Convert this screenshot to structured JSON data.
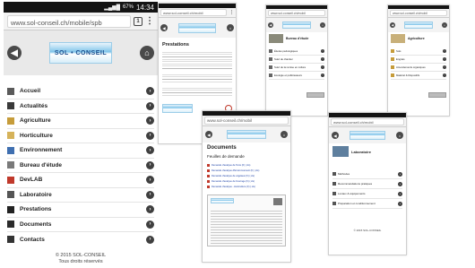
{
  "phone1": {
    "status": {
      "signal": "▂▄▆█",
      "battery": "67%",
      "time": "14:34"
    },
    "url": "www.sol-conseil.ch/mobile/spb",
    "tab_count": "1",
    "menu_glyph": "⋮",
    "logo_text": "SOL • CONSEIL",
    "menu": [
      {
        "label": "Accueil",
        "icon": "home-icon",
        "color": "#5a5a5a"
      },
      {
        "label": "Actualités",
        "icon": "news-icon",
        "color": "#3a3a3a"
      },
      {
        "label": "Agriculture",
        "icon": "agriculture-icon",
        "color": "#c69c3a"
      },
      {
        "label": "Horticulture",
        "icon": "horticulture-icon",
        "color": "#d6b35a"
      },
      {
        "label": "Environnement",
        "icon": "environment-icon",
        "color": "#3f6fb0"
      },
      {
        "label": "Bureau d'étude",
        "icon": "study-office-icon",
        "color": "#7a7a7a"
      },
      {
        "label": "DevLAB",
        "icon": "devlab-icon",
        "color": "#c0392b"
      },
      {
        "label": "Laboratoire",
        "icon": "lab-icon",
        "color": "#555555"
      },
      {
        "label": "Prestations",
        "icon": "services-icon",
        "color": "#222222"
      },
      {
        "label": "Documents",
        "icon": "documents-icon",
        "color": "#2b2b2b"
      },
      {
        "label": "Contacts",
        "icon": "contacts-icon",
        "color": "#333333"
      }
    ],
    "footer_line1": "© 2015 SOL-CONSEIL",
    "footer_line2": "Tous droits réservés"
  },
  "phone2": {
    "url": "www.sol-conseil.ch/mobil",
    "title": "Prestations"
  },
  "phone3": {
    "url": "www.sol-conseil.ch/mobil",
    "title": "Bureau d'étude",
    "items": [
      "Études pédologiques",
      "Suivi de chantier",
      "Suivi de la remise en culture",
      "Ecologie et pollinisateurs"
    ]
  },
  "phone4": {
    "url": "www.sol-conseil.ch/mobil",
    "title": "Agriculture",
    "items": [
      "Sols",
      "Engrais",
      "Amendements organiques",
      "Matériel & Dispositifs"
    ]
  },
  "phone5": {
    "url": "www.sol-conseil.ch/mobil",
    "title": "Documents",
    "subtitle": "Feuilles de demande",
    "links": [
      "Demande d'analyse de Terre (fr) (.xls)",
      "Demande d'analyse d'Environnement (fr) (.xls)",
      "Demande d'analyse de végétaux (fr) (.xls)",
      "Demande d'analyse de Fourrage (fr) (.xls)",
      "Demande d'analyse - Horticulture (fr) (.xls)"
    ]
  },
  "phone6": {
    "url": "www.sol-conseil.ch/mobil",
    "title": "Laboratoire",
    "items": [
      "Méthodes",
      "Recommandations pratiques",
      "Locaux & équipements",
      "Préparation et conditionnement"
    ],
    "footer": "© 2015 SOL-CONSEIL"
  }
}
